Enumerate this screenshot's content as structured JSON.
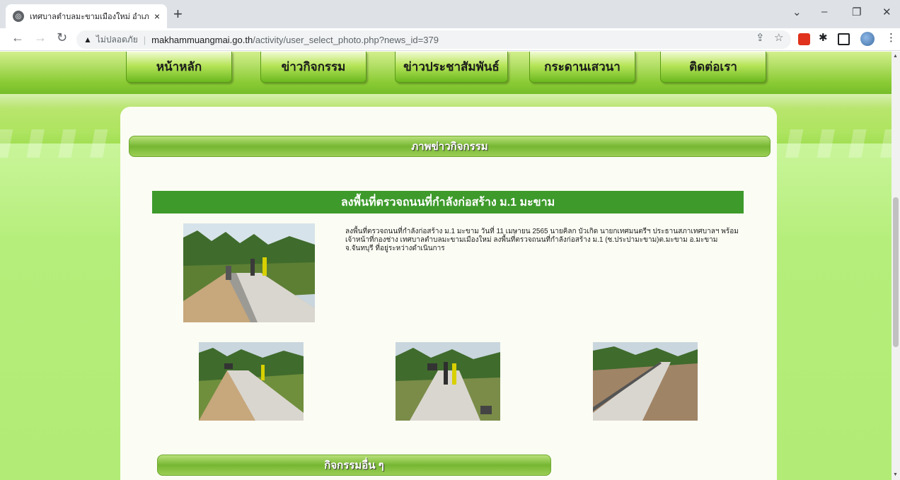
{
  "browser": {
    "tab_title": "เทศบาลตำบลมะขามเมืองใหม่ อำเภอมะ",
    "tab_close": "×",
    "new_tab": "+",
    "security_label": "ไม่ปลอดภัย",
    "url_host": "makhammuangmai.go.th",
    "url_path": "/activity/user_select_photo.php?news_id=379",
    "window_minimize": "–",
    "window_restore": "❐",
    "window_close": "✕",
    "tab_search": "⌄"
  },
  "nav": {
    "items": [
      {
        "label": "หน้าหลัก"
      },
      {
        "label": "ข่าวกิจกรรม"
      },
      {
        "label": "ข่าวประชาสัมพันธ์"
      },
      {
        "label": "กระดานเสวนา"
      },
      {
        "label": "ติดต่อเรา"
      }
    ]
  },
  "section_title": "ภาพข่าวกิจกรรม",
  "article": {
    "headline": "ลงพื้นที่ตรวจถนนที่กำลังก่อสร้าง ม.1 มะขาม",
    "description": "ลงพื้นที่ตรวจถนนที่กำลังก่อสร้าง ม.1 มะขาม วันที่ 11 เมษายน 2565 นายคิลก บัวเกิด นายกเทศมนตรีฯ ประธานสภาเทศบาลฯ พร้อมเจ้าหน้าที่กองช่าง เทศบาลตำบลมะขามเมืองใหม่ ลงพื้นที่ตรวจถนนที่กำลังก่อสร้าง ม.1 (ซ.ประปามะขาม)ต.มะขาม อ.มะขาม จ.จันทบุรี ที่อยู่ระหว่างดำเนินการ"
  },
  "other_section_title": "กิจกรรมอื่น ๆ",
  "colors": {
    "headline_bg": "#3d9a2b",
    "section_bar": "#76b632",
    "content_bg": "#fbfcf4"
  }
}
